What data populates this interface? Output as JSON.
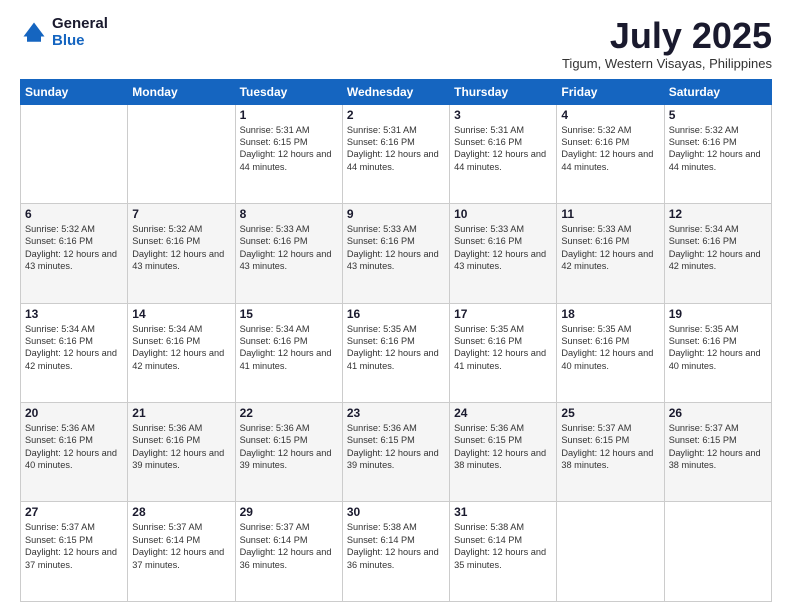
{
  "logo": {
    "general": "General",
    "blue": "Blue"
  },
  "title": {
    "month_year": "July 2025",
    "location": "Tigum, Western Visayas, Philippines"
  },
  "weekdays": [
    "Sunday",
    "Monday",
    "Tuesday",
    "Wednesday",
    "Thursday",
    "Friday",
    "Saturday"
  ],
  "weeks": [
    [
      {
        "day": "",
        "sunrise": "",
        "sunset": "",
        "daylight": ""
      },
      {
        "day": "",
        "sunrise": "",
        "sunset": "",
        "daylight": ""
      },
      {
        "day": "1",
        "sunrise": "Sunrise: 5:31 AM",
        "sunset": "Sunset: 6:15 PM",
        "daylight": "Daylight: 12 hours and 44 minutes."
      },
      {
        "day": "2",
        "sunrise": "Sunrise: 5:31 AM",
        "sunset": "Sunset: 6:16 PM",
        "daylight": "Daylight: 12 hours and 44 minutes."
      },
      {
        "day": "3",
        "sunrise": "Sunrise: 5:31 AM",
        "sunset": "Sunset: 6:16 PM",
        "daylight": "Daylight: 12 hours and 44 minutes."
      },
      {
        "day": "4",
        "sunrise": "Sunrise: 5:32 AM",
        "sunset": "Sunset: 6:16 PM",
        "daylight": "Daylight: 12 hours and 44 minutes."
      },
      {
        "day": "5",
        "sunrise": "Sunrise: 5:32 AM",
        "sunset": "Sunset: 6:16 PM",
        "daylight": "Daylight: 12 hours and 44 minutes."
      }
    ],
    [
      {
        "day": "6",
        "sunrise": "Sunrise: 5:32 AM",
        "sunset": "Sunset: 6:16 PM",
        "daylight": "Daylight: 12 hours and 43 minutes."
      },
      {
        "day": "7",
        "sunrise": "Sunrise: 5:32 AM",
        "sunset": "Sunset: 6:16 PM",
        "daylight": "Daylight: 12 hours and 43 minutes."
      },
      {
        "day": "8",
        "sunrise": "Sunrise: 5:33 AM",
        "sunset": "Sunset: 6:16 PM",
        "daylight": "Daylight: 12 hours and 43 minutes."
      },
      {
        "day": "9",
        "sunrise": "Sunrise: 5:33 AM",
        "sunset": "Sunset: 6:16 PM",
        "daylight": "Daylight: 12 hours and 43 minutes."
      },
      {
        "day": "10",
        "sunrise": "Sunrise: 5:33 AM",
        "sunset": "Sunset: 6:16 PM",
        "daylight": "Daylight: 12 hours and 43 minutes."
      },
      {
        "day": "11",
        "sunrise": "Sunrise: 5:33 AM",
        "sunset": "Sunset: 6:16 PM",
        "daylight": "Daylight: 12 hours and 42 minutes."
      },
      {
        "day": "12",
        "sunrise": "Sunrise: 5:34 AM",
        "sunset": "Sunset: 6:16 PM",
        "daylight": "Daylight: 12 hours and 42 minutes."
      }
    ],
    [
      {
        "day": "13",
        "sunrise": "Sunrise: 5:34 AM",
        "sunset": "Sunset: 6:16 PM",
        "daylight": "Daylight: 12 hours and 42 minutes."
      },
      {
        "day": "14",
        "sunrise": "Sunrise: 5:34 AM",
        "sunset": "Sunset: 6:16 PM",
        "daylight": "Daylight: 12 hours and 42 minutes."
      },
      {
        "day": "15",
        "sunrise": "Sunrise: 5:34 AM",
        "sunset": "Sunset: 6:16 PM",
        "daylight": "Daylight: 12 hours and 41 minutes."
      },
      {
        "day": "16",
        "sunrise": "Sunrise: 5:35 AM",
        "sunset": "Sunset: 6:16 PM",
        "daylight": "Daylight: 12 hours and 41 minutes."
      },
      {
        "day": "17",
        "sunrise": "Sunrise: 5:35 AM",
        "sunset": "Sunset: 6:16 PM",
        "daylight": "Daylight: 12 hours and 41 minutes."
      },
      {
        "day": "18",
        "sunrise": "Sunrise: 5:35 AM",
        "sunset": "Sunset: 6:16 PM",
        "daylight": "Daylight: 12 hours and 40 minutes."
      },
      {
        "day": "19",
        "sunrise": "Sunrise: 5:35 AM",
        "sunset": "Sunset: 6:16 PM",
        "daylight": "Daylight: 12 hours and 40 minutes."
      }
    ],
    [
      {
        "day": "20",
        "sunrise": "Sunrise: 5:36 AM",
        "sunset": "Sunset: 6:16 PM",
        "daylight": "Daylight: 12 hours and 40 minutes."
      },
      {
        "day": "21",
        "sunrise": "Sunrise: 5:36 AM",
        "sunset": "Sunset: 6:16 PM",
        "daylight": "Daylight: 12 hours and 39 minutes."
      },
      {
        "day": "22",
        "sunrise": "Sunrise: 5:36 AM",
        "sunset": "Sunset: 6:15 PM",
        "daylight": "Daylight: 12 hours and 39 minutes."
      },
      {
        "day": "23",
        "sunrise": "Sunrise: 5:36 AM",
        "sunset": "Sunset: 6:15 PM",
        "daylight": "Daylight: 12 hours and 39 minutes."
      },
      {
        "day": "24",
        "sunrise": "Sunrise: 5:36 AM",
        "sunset": "Sunset: 6:15 PM",
        "daylight": "Daylight: 12 hours and 38 minutes."
      },
      {
        "day": "25",
        "sunrise": "Sunrise: 5:37 AM",
        "sunset": "Sunset: 6:15 PM",
        "daylight": "Daylight: 12 hours and 38 minutes."
      },
      {
        "day": "26",
        "sunrise": "Sunrise: 5:37 AM",
        "sunset": "Sunset: 6:15 PM",
        "daylight": "Daylight: 12 hours and 38 minutes."
      }
    ],
    [
      {
        "day": "27",
        "sunrise": "Sunrise: 5:37 AM",
        "sunset": "Sunset: 6:15 PM",
        "daylight": "Daylight: 12 hours and 37 minutes."
      },
      {
        "day": "28",
        "sunrise": "Sunrise: 5:37 AM",
        "sunset": "Sunset: 6:14 PM",
        "daylight": "Daylight: 12 hours and 37 minutes."
      },
      {
        "day": "29",
        "sunrise": "Sunrise: 5:37 AM",
        "sunset": "Sunset: 6:14 PM",
        "daylight": "Daylight: 12 hours and 36 minutes."
      },
      {
        "day": "30",
        "sunrise": "Sunrise: 5:38 AM",
        "sunset": "Sunset: 6:14 PM",
        "daylight": "Daylight: 12 hours and 36 minutes."
      },
      {
        "day": "31",
        "sunrise": "Sunrise: 5:38 AM",
        "sunset": "Sunset: 6:14 PM",
        "daylight": "Daylight: 12 hours and 35 minutes."
      },
      {
        "day": "",
        "sunrise": "",
        "sunset": "",
        "daylight": ""
      },
      {
        "day": "",
        "sunrise": "",
        "sunset": "",
        "daylight": ""
      }
    ]
  ]
}
